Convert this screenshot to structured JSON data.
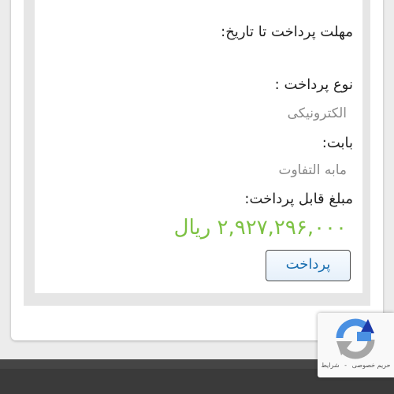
{
  "invoice": {
    "due_date_label": "مهلت پرداخت تا تاریخ:",
    "payment_type_label": "نوع پرداخت :",
    "payment_type_value": "الکترونیکی",
    "for_label": "بابت:",
    "for_value": "مابه التفاوت",
    "amount_label": "مبلغ قابل پرداخت:",
    "amount_value": "۲,۹۲۷,۲۹۶,۰۰۰ ریال",
    "pay_button_label": "پرداخت"
  },
  "recaptcha": {
    "privacy_label": "حریم خصوصی",
    "separator": "-",
    "terms_label": "شرایط"
  },
  "colors": {
    "amount": "#7cc142",
    "button_text": "#1a6fb0",
    "footer": "#3a3a3a"
  }
}
